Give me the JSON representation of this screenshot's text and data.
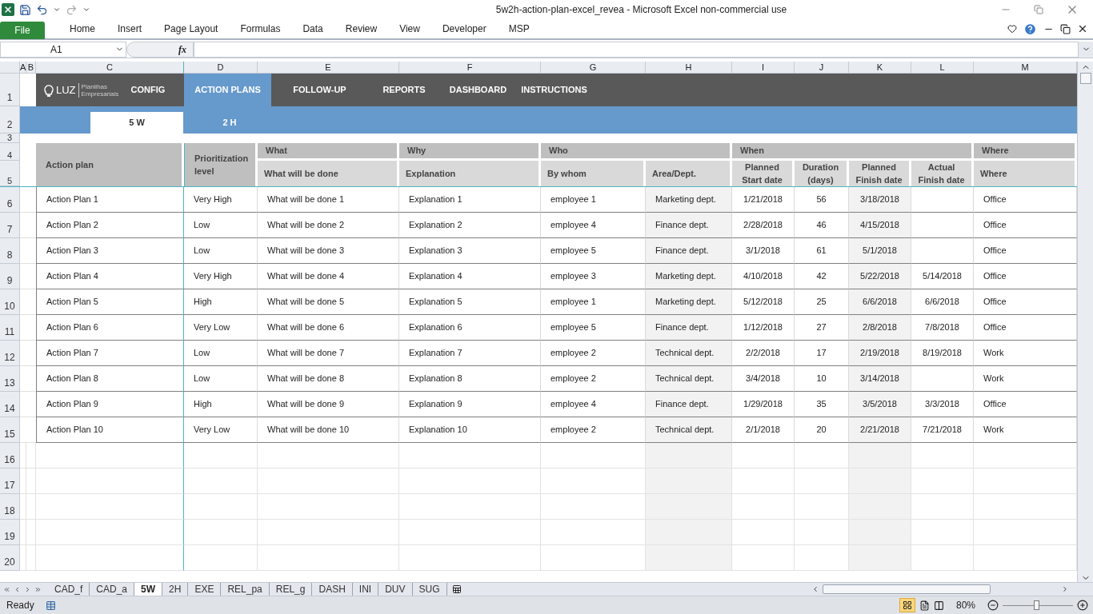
{
  "window": {
    "title": "5w2h-action-plan-excel_revea  -  Microsoft Excel non-commercial use"
  },
  "file_button": "File",
  "ribbon_tabs": [
    "Home",
    "Insert",
    "Page Layout",
    "Formulas",
    "Data",
    "Review",
    "View",
    "Developer",
    "MSP"
  ],
  "name_box": "A1",
  "function_label": "fx",
  "column_headers": [
    "A",
    "B",
    "C",
    "D",
    "E",
    "F",
    "G",
    "H",
    "I",
    "J",
    "K",
    "L",
    "M"
  ],
  "nav": {
    "logo": "LUZ",
    "logo_sub": "Planilhas Empresariais",
    "items": [
      {
        "label": "CONFIG",
        "selected": false
      },
      {
        "label": "ACTION PLANS",
        "selected": true
      },
      {
        "label": "FOLLOW-UP",
        "selected": false
      },
      {
        "label": "REPORTS",
        "selected": false
      },
      {
        "label": "DASHBOARD",
        "selected": false
      },
      {
        "label": "INSTRUCTIONS",
        "selected": false
      }
    ]
  },
  "subtabs": [
    {
      "label": "5 W",
      "selected": true
    },
    {
      "label": "2 H",
      "selected": false
    }
  ],
  "table": {
    "groups": [
      "What",
      "Why",
      "Who",
      "When",
      "Where"
    ],
    "columns": [
      "Action plan",
      "Prioritization level",
      "What will be done",
      "Explanation",
      "By whom",
      "Area/Dept.",
      "Planned Start date",
      "Duration (days)",
      "Planned Finish date",
      "Actual Finish date",
      "Where"
    ],
    "rows": [
      {
        "row": "6",
        "cells": [
          "Action Plan 1",
          "Very High",
          "What will be done 1",
          "Explanation 1",
          "employee 1",
          "Marketing dept.",
          "1/21/2018",
          "56",
          "3/18/2018",
          "",
          "Office"
        ]
      },
      {
        "row": "7",
        "cells": [
          "Action Plan 2",
          "Low",
          "What will be done 2",
          "Explanation 2",
          "employee 4",
          "Finance dept.",
          "2/28/2018",
          "46",
          "4/15/2018",
          "",
          "Office"
        ]
      },
      {
        "row": "8",
        "cells": [
          "Action Plan 3",
          "Low",
          "What will be done 3",
          "Explanation 3",
          "employee 5",
          "Finance dept.",
          "3/1/2018",
          "61",
          "5/1/2018",
          "",
          "Office"
        ]
      },
      {
        "row": "9",
        "cells": [
          "Action Plan 4",
          "Very High",
          "What will be done 4",
          "Explanation 4",
          "employee 3",
          "Marketing dept.",
          "4/10/2018",
          "42",
          "5/22/2018",
          "5/14/2018",
          "Office"
        ]
      },
      {
        "row": "10",
        "cells": [
          "Action Plan 5",
          "High",
          "What will be done 5",
          "Explanation 5",
          "employee 1",
          "Marketing dept.",
          "5/12/2018",
          "25",
          "6/6/2018",
          "6/6/2018",
          "Office"
        ]
      },
      {
        "row": "11",
        "cells": [
          "Action Plan 6",
          "Very Low",
          "What will be done 6",
          "Explanation 6",
          "employee 5",
          "Finance dept.",
          "1/12/2018",
          "27",
          "2/8/2018",
          "7/8/2018",
          "Office"
        ]
      },
      {
        "row": "12",
        "cells": [
          "Action Plan 7",
          "Low",
          "What will be done 7",
          "Explanation 7",
          "employee 2",
          "Technical dept.",
          "2/2/2018",
          "17",
          "2/19/2018",
          "8/19/2018",
          "Work"
        ]
      },
      {
        "row": "13",
        "cells": [
          "Action Plan 8",
          "Low",
          "What will be done 8",
          "Explanation 8",
          "employee 2",
          "Technical dept.",
          "3/4/2018",
          "10",
          "3/14/2018",
          "",
          "Work"
        ]
      },
      {
        "row": "14",
        "cells": [
          "Action Plan 9",
          "High",
          "What will be done 9",
          "Explanation 9",
          "employee 4",
          "Finance dept.",
          "1/29/2018",
          "35",
          "3/5/2018",
          "3/3/2018",
          "Office"
        ]
      },
      {
        "row": "15",
        "cells": [
          "Action Plan 10",
          "Very Low",
          "What will be done 10",
          "Explanation 10",
          "employee 2",
          "Technical dept.",
          "2/1/2018",
          "20",
          "2/21/2018",
          "7/21/2018",
          "Work"
        ]
      }
    ]
  },
  "header_row_numbers": [
    "1",
    "2",
    "3",
    "4",
    "5"
  ],
  "empty_row_numbers": [
    "16",
    "17",
    "18",
    "19",
    "20"
  ],
  "sheet_tabs": [
    {
      "label": "CAD_f",
      "selected": false
    },
    {
      "label": "CAD_a",
      "selected": false
    },
    {
      "label": "5W",
      "selected": true
    },
    {
      "label": "2H",
      "selected": false
    },
    {
      "label": "EXE",
      "selected": false
    },
    {
      "label": "REL_pa",
      "selected": false
    },
    {
      "label": "REL_g",
      "selected": false
    },
    {
      "label": "DASH",
      "selected": false
    },
    {
      "label": "INI",
      "selected": false
    },
    {
      "label": "DUV",
      "selected": false
    },
    {
      "label": "SUG",
      "selected": false
    }
  ],
  "status_bar": {
    "status": "Ready",
    "zoom": "80%",
    "zoom_slider": {
      "level": 0.48
    }
  }
}
